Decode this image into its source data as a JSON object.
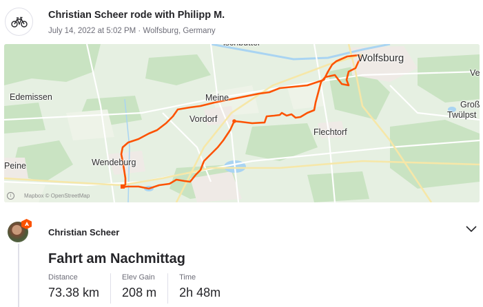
{
  "header": {
    "title": "Christian Scheer rode with Philipp M.",
    "meta": "July 14, 2022 at 5:02 PM · Wolfsburg, Germany",
    "icon": "bike-icon"
  },
  "map": {
    "labels": {
      "wolfsburg": "Wolfsburg",
      "fischbutter": "ischbutter",
      "edemissen": "Edemissen",
      "meine": "Meine",
      "vordorf": "Vordorf",
      "flechtorf": "Flechtorf",
      "peine": "Peine",
      "wendeburg": "Wendeburg",
      "vel": "Ve",
      "gross": "Groß",
      "twuelpst": "Twülpst"
    },
    "attribution": "Mapbox   © OpenStreetMap",
    "route_color": "#fc5200"
  },
  "athlete": {
    "name": "Christian Scheer"
  },
  "activity": {
    "title": "Fahrt am Nachmittag",
    "stats": [
      {
        "label": "Distance",
        "value": "73.38 km"
      },
      {
        "label": "Elev Gain",
        "value": "208 m"
      },
      {
        "label": "Time",
        "value": "2h 48m"
      }
    ]
  }
}
